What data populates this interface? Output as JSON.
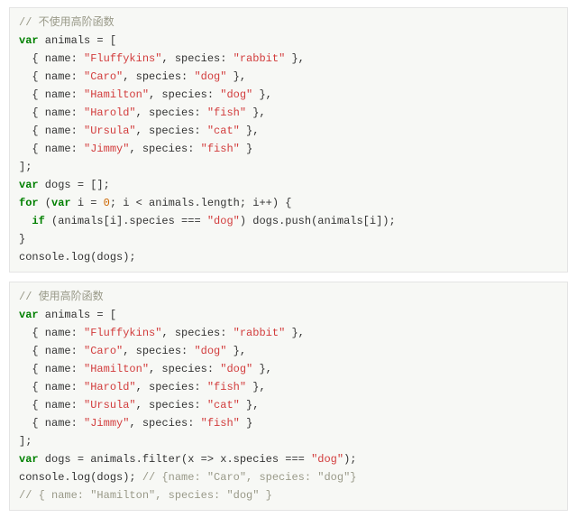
{
  "blocks": [
    {
      "lines": [
        [
          [
            "comment",
            "// 不使用高阶函数"
          ]
        ],
        [
          [
            "keyword",
            "var"
          ],
          [
            "ident",
            " animals = ["
          ]
        ],
        [
          [
            "ident",
            "  { name: "
          ],
          [
            "string",
            "\"Fluffykins\""
          ],
          [
            "ident",
            ", species: "
          ],
          [
            "string",
            "\"rabbit\""
          ],
          [
            "ident",
            " },"
          ]
        ],
        [
          [
            "ident",
            "  { name: "
          ],
          [
            "string",
            "\"Caro\""
          ],
          [
            "ident",
            ", species: "
          ],
          [
            "string",
            "\"dog\""
          ],
          [
            "ident",
            " },"
          ]
        ],
        [
          [
            "ident",
            "  { name: "
          ],
          [
            "string",
            "\"Hamilton\""
          ],
          [
            "ident",
            ", species: "
          ],
          [
            "string",
            "\"dog\""
          ],
          [
            "ident",
            " },"
          ]
        ],
        [
          [
            "ident",
            "  { name: "
          ],
          [
            "string",
            "\"Harold\""
          ],
          [
            "ident",
            ", species: "
          ],
          [
            "string",
            "\"fish\""
          ],
          [
            "ident",
            " },"
          ]
        ],
        [
          [
            "ident",
            "  { name: "
          ],
          [
            "string",
            "\"Ursula\""
          ],
          [
            "ident",
            ", species: "
          ],
          [
            "string",
            "\"cat\""
          ],
          [
            "ident",
            " },"
          ]
        ],
        [
          [
            "ident",
            "  { name: "
          ],
          [
            "string",
            "\"Jimmy\""
          ],
          [
            "ident",
            ", species: "
          ],
          [
            "string",
            "\"fish\""
          ],
          [
            "ident",
            " }"
          ]
        ],
        [
          [
            "ident",
            "];"
          ]
        ],
        [
          [
            "keyword",
            "var"
          ],
          [
            "ident",
            " dogs = [];"
          ]
        ],
        [
          [
            "keyword",
            "for"
          ],
          [
            "ident",
            " ("
          ],
          [
            "keyword",
            "var"
          ],
          [
            "ident",
            " i = "
          ],
          [
            "number",
            "0"
          ],
          [
            "ident",
            "; i < animals.length; i++) {"
          ]
        ],
        [
          [
            "ident",
            "  "
          ],
          [
            "keyword",
            "if"
          ],
          [
            "ident",
            " (animals[i].species === "
          ],
          [
            "string",
            "\"dog\""
          ],
          [
            "ident",
            ") dogs.push(animals[i]);"
          ]
        ],
        [
          [
            "ident",
            "}"
          ]
        ],
        [
          [
            "ident",
            "console.log(dogs);"
          ]
        ]
      ]
    },
    {
      "lines": [
        [
          [
            "comment",
            "// 使用高阶函数"
          ]
        ],
        [
          [
            "keyword",
            "var"
          ],
          [
            "ident",
            " animals = ["
          ]
        ],
        [
          [
            "ident",
            "  { name: "
          ],
          [
            "string",
            "\"Fluffykins\""
          ],
          [
            "ident",
            ", species: "
          ],
          [
            "string",
            "\"rabbit\""
          ],
          [
            "ident",
            " },"
          ]
        ],
        [
          [
            "ident",
            "  { name: "
          ],
          [
            "string",
            "\"Caro\""
          ],
          [
            "ident",
            ", species: "
          ],
          [
            "string",
            "\"dog\""
          ],
          [
            "ident",
            " },"
          ]
        ],
        [
          [
            "ident",
            "  { name: "
          ],
          [
            "string",
            "\"Hamilton\""
          ],
          [
            "ident",
            ", species: "
          ],
          [
            "string",
            "\"dog\""
          ],
          [
            "ident",
            " },"
          ]
        ],
        [
          [
            "ident",
            "  { name: "
          ],
          [
            "string",
            "\"Harold\""
          ],
          [
            "ident",
            ", species: "
          ],
          [
            "string",
            "\"fish\""
          ],
          [
            "ident",
            " },"
          ]
        ],
        [
          [
            "ident",
            "  { name: "
          ],
          [
            "string",
            "\"Ursula\""
          ],
          [
            "ident",
            ", species: "
          ],
          [
            "string",
            "\"cat\""
          ],
          [
            "ident",
            " },"
          ]
        ],
        [
          [
            "ident",
            "  { name: "
          ],
          [
            "string",
            "\"Jimmy\""
          ],
          [
            "ident",
            ", species: "
          ],
          [
            "string",
            "\"fish\""
          ],
          [
            "ident",
            " }"
          ]
        ],
        [
          [
            "ident",
            "];"
          ]
        ],
        [
          [
            "keyword",
            "var"
          ],
          [
            "ident",
            " dogs = animals.filter(x => x.species === "
          ],
          [
            "string",
            "\"dog\""
          ],
          [
            "ident",
            ");"
          ]
        ],
        [
          [
            "ident",
            "console.log(dogs); "
          ],
          [
            "comment",
            "// {name: \"Caro\", species: \"dog\"}"
          ]
        ],
        [
          [
            "comment",
            "// { name: \"Hamilton\", species: \"dog\" }"
          ]
        ]
      ]
    }
  ]
}
